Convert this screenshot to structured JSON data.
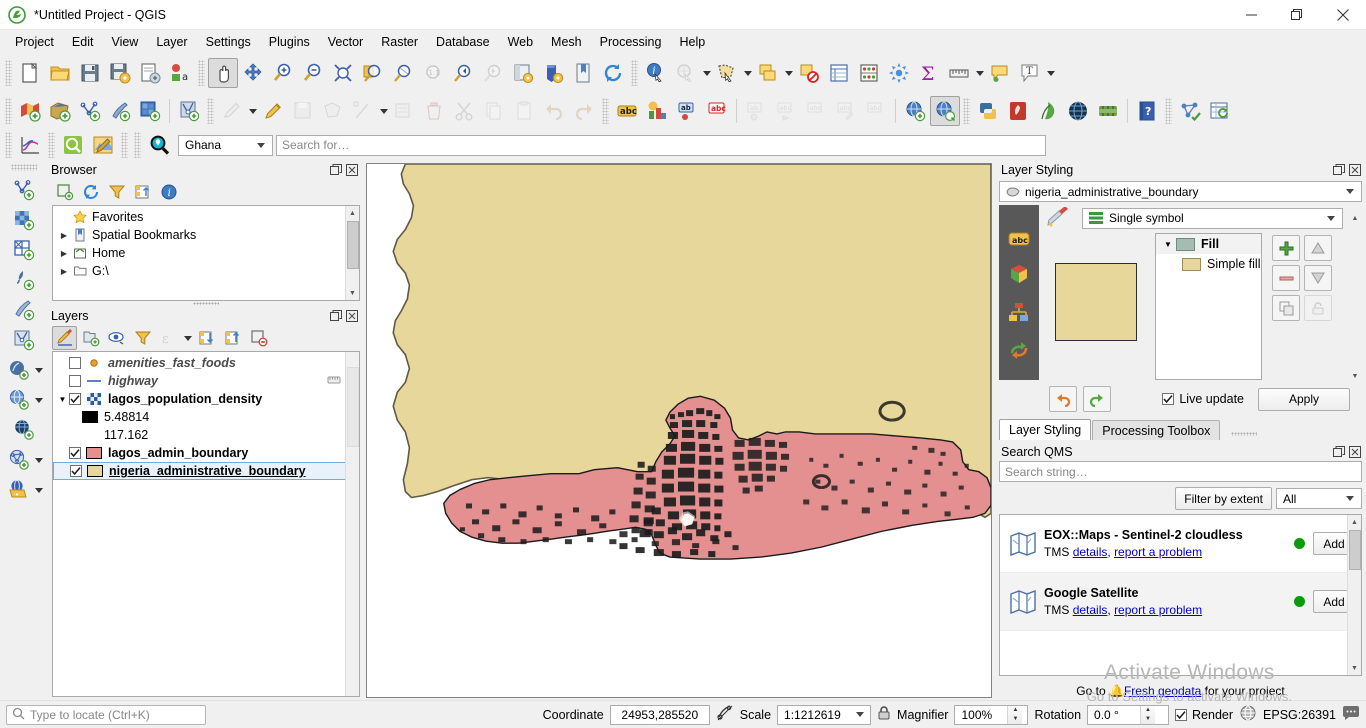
{
  "window": {
    "title": "*Untitled Project - QGIS",
    "minimize": "─",
    "restore": "❐",
    "close": "✕"
  },
  "menubar": {
    "items": [
      {
        "label": "Project"
      },
      {
        "label": "Edit"
      },
      {
        "label": "View"
      },
      {
        "label": "Layer"
      },
      {
        "label": "Settings"
      },
      {
        "label": "Plugins"
      },
      {
        "label": "Vector"
      },
      {
        "label": "Raster"
      },
      {
        "label": "Database"
      },
      {
        "label": "Web"
      },
      {
        "label": "Mesh"
      },
      {
        "label": "Processing"
      },
      {
        "label": "Help"
      }
    ]
  },
  "toolbar_project": [
    {
      "name": "new-project-icon",
      "tip": "New Project"
    },
    {
      "name": "open-project-icon",
      "tip": "Open Project"
    },
    {
      "name": "save-project-icon",
      "tip": "Save Project"
    },
    {
      "name": "save-project-as-icon",
      "tip": "Save Project As"
    },
    {
      "name": "new-print-layout-icon",
      "tip": "New Print Layout"
    },
    {
      "name": "style-manager-icon",
      "tip": "Style Manager"
    }
  ],
  "toolbar_navigation": [
    {
      "name": "pan-map-icon",
      "tip": "Pan Map",
      "pressed": true
    },
    {
      "name": "pan-to-selection-icon",
      "tip": "Pan Map to Selection"
    },
    {
      "name": "zoom-in-icon",
      "tip": "Zoom In"
    },
    {
      "name": "zoom-out-icon",
      "tip": "Zoom Out"
    },
    {
      "name": "zoom-full-icon",
      "tip": "Zoom Full"
    },
    {
      "name": "zoom-to-selection-icon",
      "tip": "Zoom to Selection"
    },
    {
      "name": "zoom-to-layer-icon",
      "tip": "Zoom to Layer"
    },
    {
      "name": "zoom-native-icon",
      "tip": "Zoom to Native Resolution",
      "disabled": true
    },
    {
      "name": "zoom-last-icon",
      "tip": "Zoom Last"
    },
    {
      "name": "zoom-next-icon",
      "tip": "Zoom Next",
      "disabled": true
    },
    {
      "name": "new-map-view-icon",
      "tip": "New Map View"
    },
    {
      "name": "new-3d-map-view-icon",
      "tip": "New 3D Map View"
    },
    {
      "name": "show-bookmarks-icon",
      "tip": "Show Bookmarks"
    },
    {
      "name": "refresh-icon",
      "tip": "Refresh"
    }
  ],
  "toolbar_attributes": [
    {
      "name": "identify-features-icon",
      "tip": "Identify Features"
    },
    {
      "name": "run-feature-action-icon",
      "tip": "Run Feature Action",
      "disabled": true,
      "dropdown": true
    },
    {
      "name": "select-features-icon",
      "tip": "Select Features by Area",
      "dropdown": true
    },
    {
      "name": "select-by-value-icon",
      "tip": "Select by Value",
      "dropdown": true
    },
    {
      "name": "deselect-features-icon",
      "tip": "Deselect Features"
    },
    {
      "name": "open-attribute-table-icon",
      "tip": "Open Attribute Table"
    },
    {
      "name": "field-calculator-icon",
      "tip": "Field Calculator"
    },
    {
      "name": "processing-toolbox-icon",
      "tip": "Processing Toolbox"
    },
    {
      "name": "statistical-summary-icon",
      "tip": "Statistical Summary"
    },
    {
      "name": "measure-line-icon",
      "tip": "Measure Line",
      "dropdown": true
    },
    {
      "name": "map-tips-icon",
      "tip": "Show Map Tips"
    },
    {
      "name": "text-annotation-icon",
      "tip": "Text Annotation",
      "dropdown": true
    }
  ],
  "toolbar_manage_layers": [
    {
      "name": "add-vector-layer-icon",
      "tip": "Add Vector Layer"
    },
    {
      "name": "add-raster-layer-icon",
      "tip": "Add Raster Layer"
    },
    {
      "name": "add-mesh-layer-icon",
      "tip": "Add Mesh Layer"
    },
    {
      "name": "add-delimited-text-layer-icon",
      "tip": "Add Delimited Text Layer"
    },
    {
      "name": "add-virtual-layer-icon",
      "tip": "Add Virtual Layer"
    }
  ],
  "toolbar_digitizing": [
    {
      "name": "current-edits-icon",
      "tip": "Current Edits",
      "disabled": true,
      "dropdown": true
    },
    {
      "name": "toggle-editing-icon",
      "tip": "Toggle Editing"
    },
    {
      "name": "save-layer-edits-icon",
      "tip": "Save Layer Edits",
      "disabled": true
    },
    {
      "name": "add-polygon-feature-icon",
      "tip": "Add Polygon Feature",
      "disabled": true
    },
    {
      "name": "vertex-tool-icon",
      "tip": "Vertex Tool",
      "disabled": true,
      "dropdown": true
    },
    {
      "name": "modify-attributes-icon",
      "tip": "Modify Attributes of Selected Features",
      "disabled": true
    },
    {
      "name": "delete-selected-icon",
      "tip": "Delete Selected",
      "disabled": true
    },
    {
      "name": "cut-features-icon",
      "tip": "Cut Features",
      "disabled": true
    },
    {
      "name": "copy-features-icon",
      "tip": "Copy Features",
      "disabled": true
    },
    {
      "name": "paste-features-icon",
      "tip": "Paste Features",
      "disabled": true
    },
    {
      "name": "undo-icon",
      "tip": "Undo",
      "disabled": true
    },
    {
      "name": "redo-icon",
      "tip": "Redo",
      "disabled": true
    }
  ],
  "toolbar_label": [
    {
      "name": "labeling-icon",
      "tip": "Layer Labeling Options"
    },
    {
      "name": "layer-diagram-icon",
      "tip": "Layer Diagram Options"
    },
    {
      "name": "highlight-pinned-labels-icon",
      "tip": "Highlight Pinned Labels"
    },
    {
      "name": "pin-labels-icon",
      "tip": "Pin/Unpin Labels",
      "disabled": true
    },
    {
      "name": "show-hide-labels-icon",
      "tip": "Show/Hide Labels",
      "disabled": true
    },
    {
      "name": "move-label-icon",
      "tip": "Move Label",
      "disabled": true
    },
    {
      "name": "rotate-label-icon",
      "tip": "Rotate Label",
      "disabled": true
    },
    {
      "name": "change-label-icon",
      "tip": "Change Label",
      "disabled": true
    }
  ],
  "toolbar_web": [
    {
      "name": "metasearch-icon",
      "tip": "MetaSearch"
    },
    {
      "name": "qms-search-icon",
      "tip": "Search QMS",
      "pressed": true
    }
  ],
  "toolbar_plugins": [
    {
      "name": "python-console-icon",
      "tip": "Python Console"
    },
    {
      "name": "qgis2web-icon",
      "tip": "qgis2web"
    },
    {
      "name": "qfield-sync-icon",
      "tip": "QField Sync"
    },
    {
      "name": "openlayers-icon",
      "tip": "OpenLayers Plugin"
    },
    {
      "name": "freehand-icon",
      "tip": "Freehand Editing"
    },
    {
      "name": "help-icon",
      "tip": "Help"
    },
    {
      "name": "topology-checker-icon",
      "tip": "Topology Checker"
    },
    {
      "name": "refresh-table-icon",
      "tip": "Refresh Table"
    }
  ],
  "toolbar_datasource": [
    {
      "name": "data-source-manager-icon",
      "tip": "Data Source Manager"
    },
    {
      "name": "plot-icon",
      "tip": "Data Plotly"
    },
    {
      "name": "qms-magnifier-icon",
      "tip": "QuickMapServices"
    },
    {
      "name": "map-editor-icon",
      "tip": "Map Editor"
    }
  ],
  "qms_search_bar": {
    "icon": "qms-pin-icon",
    "country_selected": "Ghana",
    "search_placeholder": "Search for…",
    "search_value": ""
  },
  "vertical_toolbar": [
    {
      "name": "add-vector-layer-icon"
    },
    {
      "name": "add-raster-layer-icon"
    },
    {
      "name": "add-mesh-layer-icon"
    },
    {
      "name": "add-delimited-text-layer-icon"
    },
    {
      "name": "add-virtual-layer-icon"
    },
    {
      "name": "add-wfs-layer-icon"
    },
    {
      "name": "add-postgis-layer-icon",
      "dropdown": true
    },
    {
      "name": "add-wms-layer-icon",
      "dropdown": true
    },
    {
      "name": "add-wcs-layer-icon"
    },
    {
      "name": "add-spatialite-layer-icon",
      "dropdown": true
    },
    {
      "name": "add-arcgis-layer-icon",
      "dropdown": true
    }
  ],
  "browser_panel": {
    "title": "Browser",
    "float_icon": "float-panel-icon",
    "close_icon": "close-panel-icon",
    "toolbar": [
      {
        "name": "add-layer-icon",
        "tip": "Add Selected Layers"
      },
      {
        "name": "refresh-icon",
        "tip": "Refresh"
      },
      {
        "name": "filter-browser-icon",
        "tip": "Filter Browser"
      },
      {
        "name": "collapse-all-icon",
        "tip": "Collapse All"
      },
      {
        "name": "properties-icon",
        "tip": "Properties"
      }
    ],
    "items": [
      {
        "label": "Favorites",
        "icon": "star-icon",
        "expandable": false
      },
      {
        "label": "Spatial Bookmarks",
        "icon": "bookmark-icon",
        "expandable": true
      },
      {
        "label": "Home",
        "icon": "home-icon",
        "expandable": true
      },
      {
        "label": "G:\\",
        "icon": "folder-icon",
        "expandable": true
      }
    ]
  },
  "layers_panel": {
    "title": "Layers",
    "float_icon": "float-panel-icon",
    "close_icon": "close-panel-icon",
    "toolbar": [
      {
        "name": "open-layer-styling-panel-icon",
        "tip": "Open the Layer Styling panel",
        "pressed": true
      },
      {
        "name": "add-group-icon",
        "tip": "Add Group"
      },
      {
        "name": "manage-map-themes-icon",
        "tip": "Manage Map Themes"
      },
      {
        "name": "filter-legend-icon",
        "tip": "Filter Legend"
      },
      {
        "name": "filter-legend-expression-icon",
        "tip": "Filter Legend by Expression",
        "disabled": true,
        "dropdown": true
      },
      {
        "name": "expand-all-icon",
        "tip": "Expand All"
      },
      {
        "name": "collapse-all-icon",
        "tip": "Collapse All"
      },
      {
        "name": "remove-layer-icon",
        "tip": "Remove Layer/Group"
      }
    ],
    "layers": [
      {
        "name": "amenities_fast_foods",
        "checked": false,
        "style": "italic",
        "symbol": "point",
        "color": "#e8a22a",
        "expandable": false
      },
      {
        "name": "highway",
        "checked": false,
        "style": "italic",
        "symbol": "line",
        "color": "#3b5fb0",
        "expandable": false,
        "has_edit_badge": true
      },
      {
        "name": "lagos_population_density",
        "checked": true,
        "style": "bold",
        "symbol": "raster",
        "expandable": true,
        "expanded": true
      },
      {
        "name": "lagos_admin_boundary",
        "checked": true,
        "style": "bold",
        "symbol": "fill",
        "color": "#e49090",
        "expandable": false
      },
      {
        "name": "nigeria_administrative_boundary",
        "checked": true,
        "style": "underline",
        "symbol": "fill",
        "color": "#e8d79b",
        "expandable": false,
        "selected": true
      }
    ],
    "raster_legend": [
      {
        "value": "5.48814",
        "color": "#000000"
      },
      {
        "value": "117.162",
        "color": "#ffffff"
      }
    ]
  },
  "layer_styling": {
    "title": "Layer Styling",
    "float_icon": "float-panel-icon",
    "close_icon": "close-panel-icon",
    "layer_combo": "nigeria_administrative_boundary",
    "layer_combo_icon": "polygon-layer-icon",
    "renderer": "Single symbol",
    "renderer_icon": "single-symbol-icon",
    "side_tabs": [
      {
        "name": "labels-tab-icon"
      },
      {
        "name": "3d-view-tab-icon"
      },
      {
        "name": "diagrams-tab-icon"
      },
      {
        "name": "history-tab-icon"
      }
    ],
    "preview_color": "#e8d79b",
    "symbol_tree": [
      {
        "label": "Fill",
        "color": "#a5bcb0",
        "level": 0,
        "bold": true
      },
      {
        "label": "Simple fill",
        "color": "#e8d79b",
        "level": 1,
        "bold": false
      }
    ],
    "buttons": {
      "add_symbol_layer": "add-symbol-layer-icon",
      "remove_symbol_layer": "remove-symbol-layer-icon",
      "duplicate_symbol_layer": "duplicate-symbol-layer-icon",
      "move_up": "move-up-icon",
      "move_down": "move-down-icon",
      "lock": "lock-icon"
    },
    "undo_icon": "undo-icon",
    "redo_icon": "redo-icon",
    "live_update_label": "Live update",
    "live_update_checked": true,
    "apply_label": "Apply"
  },
  "dock_tabs": [
    {
      "label": "Layer Styling",
      "active": true
    },
    {
      "label": "Processing Toolbox",
      "active": false
    }
  ],
  "qms_panel": {
    "title": "Search QMS",
    "float_icon": "float-panel-icon",
    "close_icon": "close-panel-icon",
    "search_placeholder": "Search string…",
    "search_value": "",
    "filter_button": "Filter by extent",
    "filter_select": "All",
    "results": [
      {
        "title": "EOX::Maps - Sentinel-2 cloudless",
        "type": "TMS",
        "details_link": "details",
        "separator": ",",
        "report_link": "report a problem",
        "status_color": "#0a9b0a",
        "add_label": "Add",
        "icon": "map-service-icon"
      },
      {
        "title": "Google Satellite",
        "type": "TMS",
        "details_link": "details",
        "separator": ",",
        "report_link": "report a problem",
        "status_color": "#0a9b0a",
        "add_label": "Add",
        "icon": "map-service-icon"
      }
    ]
  },
  "fresh_geodata": {
    "prefix": "Go to ",
    "link": "Fresh geodata",
    "suffix": " for your project",
    "bell_icon": "bell-icon"
  },
  "watermark": {
    "line1": "Activate Windows",
    "line2": "Go to Settings to activate Windows."
  },
  "statusbar": {
    "locator_placeholder": "Type to locate (Ctrl+K)",
    "locator_icon": "search-icon",
    "coordinate_label": "Coordinate",
    "coordinate_value": "24953,285520",
    "toggle_extents_icon": "toggle-extents-icon",
    "scale_label": "Scale",
    "scale_value": "1:1212619",
    "lock_icon": "lock-scale-icon",
    "magnifier_label": "Magnifier",
    "magnifier_value": "100%",
    "rotation_label": "Rotation",
    "rotation_value": "0.0 °",
    "render_label": "Render",
    "render_checked": true,
    "crs_icon": "crs-icon",
    "crs_value": "EPSG:26391",
    "messages_icon": "messages-icon"
  },
  "map": {
    "background": "#ffffff",
    "nigeria_fill": "#e8d79b",
    "nigeria_stroke": "#5f5a43",
    "lagos_fill": "#e49090",
    "lagos_stroke": "#000000",
    "density_color": "#1a1a1a"
  }
}
